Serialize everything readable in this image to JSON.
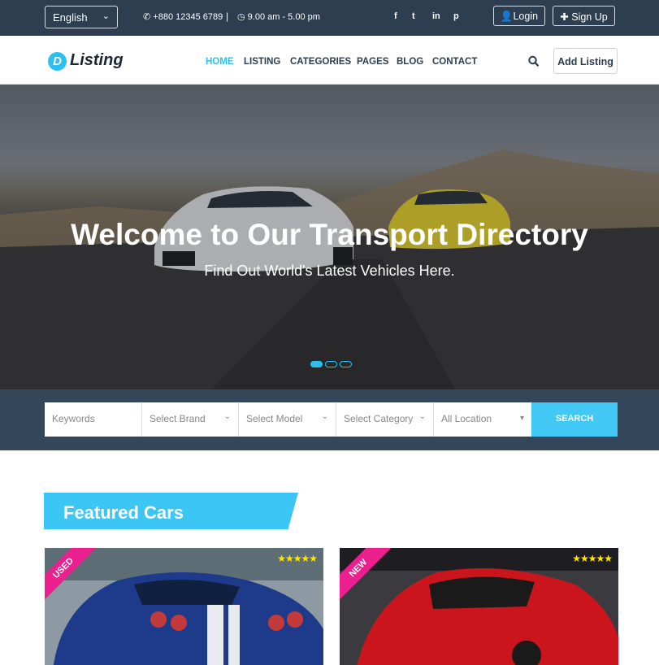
{
  "topbar": {
    "language": "English",
    "phone": "+880 12345 6789",
    "separator": "|",
    "hours": "9.00 am - 5.00 pm",
    "social": [
      "f",
      "t",
      "in",
      "p"
    ],
    "login": "Login",
    "signup": "Sign Up"
  },
  "nav": {
    "logo_letter": "D",
    "logo_text": "Listing",
    "items": [
      "HOME",
      "LISTING",
      "CATEGORIES",
      "PAGES",
      "BLOG",
      "CONTACT"
    ],
    "active_item": "HOME",
    "add_listing": "Add Listing"
  },
  "hero": {
    "title": "Welcome to Our Transport Directory",
    "subtitle": "Find Out World's Latest Vehicles Here.",
    "slides": 3,
    "active_slide": 1
  },
  "search": {
    "keywords_placeholder": "Keywords",
    "brand": "Select Brand",
    "model": "Select Model",
    "category": "Select Category",
    "location": "All Location",
    "button": "SEARCH"
  },
  "featured": {
    "title": "Featured Cars",
    "cards": [
      {
        "badge": "USED",
        "stars": "★★★★★",
        "badge_color": "#ec1f8e"
      },
      {
        "badge": "NEW",
        "stars": "★★★★★",
        "badge_color": "#ec1f8e"
      }
    ]
  },
  "colors": {
    "accent": "#2bc0f0",
    "topbar": "#2c3e50",
    "search_band": "#34465a",
    "badge": "#ec1f8e",
    "stars": "#ffe600"
  }
}
